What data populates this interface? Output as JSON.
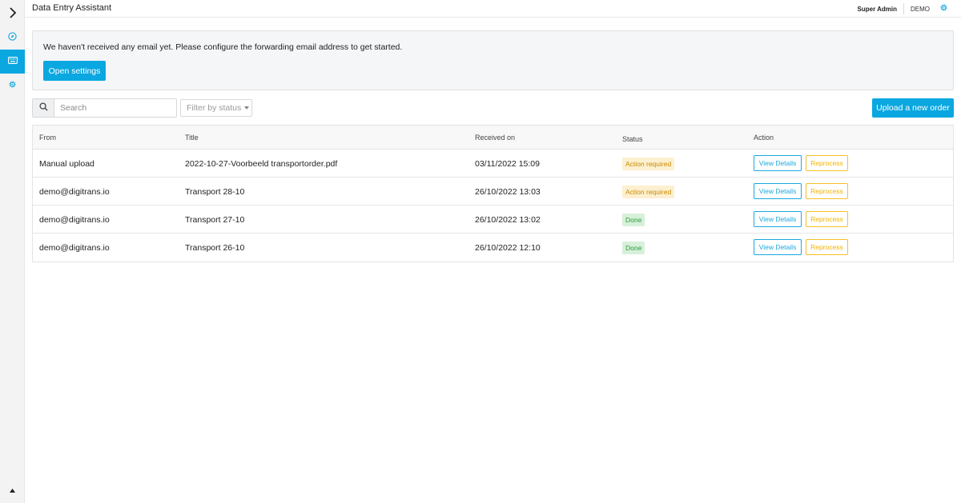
{
  "header": {
    "title": "Data Entry Assistant",
    "user": "Super Admin",
    "org": "DEMO"
  },
  "sidebar": {
    "items": [
      {
        "icon": "compass-icon",
        "active": false
      },
      {
        "icon": "keyboard-icon",
        "active": true
      },
      {
        "icon": "gear-icon",
        "active": false
      }
    ]
  },
  "alert": {
    "message": "We haven't received any email yet. Please configure the forwarding email address to get started.",
    "button_label": "Open settings"
  },
  "toolbar": {
    "search_placeholder": "Search",
    "filter_placeholder": "Filter by status",
    "upload_label": "Upload a new order"
  },
  "table": {
    "columns": {
      "from": "From",
      "title": "Title",
      "received": "Received on",
      "status": "Status",
      "action": "Action"
    },
    "rows": [
      {
        "from": "Manual upload",
        "title": "2022-10-27-Voorbeeld transportorder.pdf",
        "received": "03/11/2022 15:09",
        "status": "Action required",
        "status_type": "warn"
      },
      {
        "from": "demo@digitrans.io",
        "title": "Transport 28-10",
        "received": "26/10/2022 13:03",
        "status": "Action required",
        "status_type": "warn"
      },
      {
        "from": "demo@digitrans.io",
        "title": "Transport 27-10",
        "received": "26/10/2022 13:02",
        "status": "Done",
        "status_type": "ok"
      },
      {
        "from": "demo@digitrans.io",
        "title": "Transport 26-10",
        "received": "26/10/2022 12:10",
        "status": "Done",
        "status_type": "ok"
      }
    ],
    "view_label": "View Details",
    "reprocess_label": "Reprocess"
  },
  "colors": {
    "accent": "#0aa7e0",
    "warning": "#f0b400",
    "success": "#2f9a3b"
  }
}
